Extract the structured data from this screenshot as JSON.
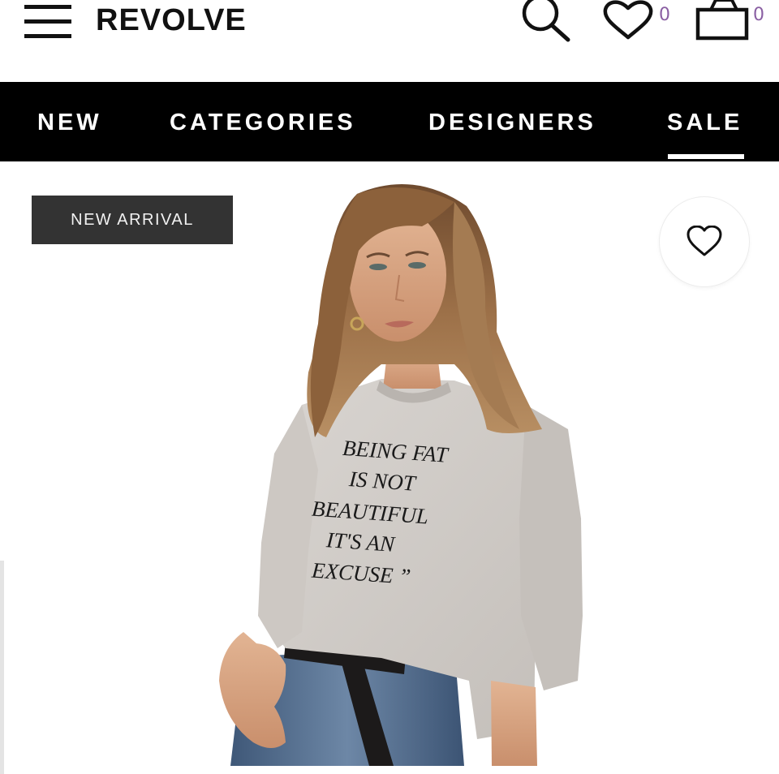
{
  "header": {
    "logo": "REVOLVE",
    "wishlist_count": "0",
    "bag_count": "0",
    "icons": [
      "menu-icon",
      "search-icon",
      "heart-icon",
      "bag-icon"
    ]
  },
  "nav": {
    "items": [
      "NEW",
      "CATEGORIES",
      "DESIGNERS",
      "SALE"
    ],
    "active": "SALE"
  },
  "product": {
    "badge": "NEW ARRIVAL",
    "print_lines": [
      "BEING FAT",
      "IS NOT",
      "BEAUTIFUL",
      "IT'S AN",
      "EXCUSE ”"
    ],
    "favorite_icon": "heart-outline-icon"
  },
  "colors": {
    "nav_background": "#000000",
    "badge_background": "#333333",
    "count_accent": "#8a5fa3",
    "sweatshirt": "#cfcac5",
    "jeans": "#4f6a8c"
  }
}
